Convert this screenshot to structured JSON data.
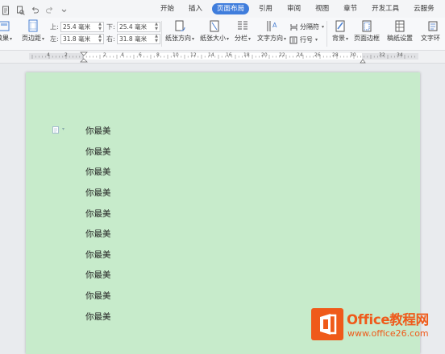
{
  "tabs": [
    "开始",
    "插入",
    "页面布局",
    "引用",
    "审阅",
    "视图",
    "章节",
    "开发工具",
    "云服务"
  ],
  "active_tab": "页面布局",
  "ribbon": {
    "theme_label": "效果",
    "margins_label": "页边距",
    "margin_top_label": "上:",
    "margin_top_value": "25.4 毫米",
    "margin_bottom_label": "下:",
    "margin_bottom_value": "25.4 毫米",
    "margin_left_label": "左:",
    "margin_left_value": "31.8 毫米",
    "margin_right_label": "右:",
    "margin_right_value": "31.8 毫米",
    "orientation_label": "纸张方向",
    "size_label": "纸张大小",
    "columns_label": "分栏",
    "text_direction_label": "文字方向",
    "breaks_label": "分隔符",
    "line_numbers_label": "行号",
    "background_label": "背景",
    "page_border_label": "页面边框",
    "paper_settings_label": "稿纸设置",
    "text_wrap_label": "文字环"
  },
  "ruler": {
    "numbers": [
      "4",
      "2",
      "2",
      "4",
      "6",
      "8",
      "10",
      "12",
      "14",
      "16",
      "18",
      "20",
      "22",
      "24",
      "26",
      "28",
      "30",
      "32",
      "34"
    ]
  },
  "document": {
    "lines": [
      "你最美",
      "你最美",
      "你最美",
      "你最美",
      "你最美",
      "你最美",
      "你最美",
      "你最美",
      "你最美",
      "你最美"
    ],
    "background_color": "#c7ebcb"
  },
  "watermark": {
    "title": "Office教程网",
    "url": "www.office26.com",
    "color": "#ef5a1a"
  },
  "icons": {
    "quick_access": [
      "file-icon",
      "print-preview-icon",
      "undo-icon",
      "redo-icon",
      "dropdown-icon"
    ],
    "paragraph_marker": "paragraph-icon"
  }
}
